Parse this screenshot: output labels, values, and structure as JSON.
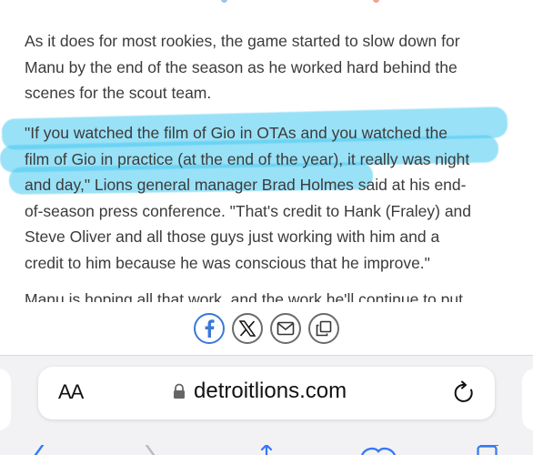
{
  "article": {
    "paragraph1": [
      "As it does for most rookies, the game started to slow down for",
      "Manu by the end of the season as he worked hard behind the",
      "scenes for the scout team."
    ],
    "paragraph2": [
      "\"If you watched the film of Gio in OTAs and you watched the",
      "film of Gio in practice (at the end of the year), it really was night",
      "and day,\" Lions general manager Brad Holmes said at his end-",
      "of-season press conference. \"That's credit to Hank (Fraley) and",
      "Steve Oliver and all those guys just working with him and a",
      "credit to him because he was conscious that he improve.\""
    ],
    "paragraph3_partial": "Manu is hoping all that work, and the work he'll continue to put"
  },
  "share": {
    "icons": [
      "facebook-icon",
      "x-icon",
      "email-icon",
      "copy-icon"
    ]
  },
  "browser": {
    "text_size_label": "AA",
    "url": "detroitlions.com",
    "icons": [
      "lock-icon",
      "reload-icon",
      "back-icon",
      "forward-icon",
      "share-icon",
      "bookmarks-icon",
      "tabs-icon"
    ]
  },
  "colors": {
    "highlight": "#46c8f0",
    "facebook": "#3a78d8",
    "text": "#3b3b3b"
  }
}
